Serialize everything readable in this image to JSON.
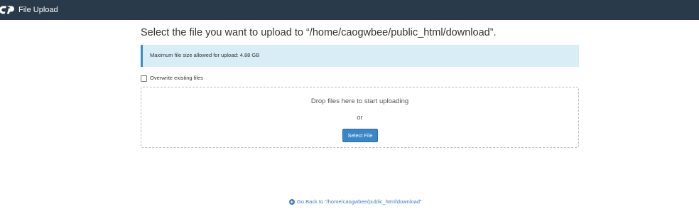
{
  "header": {
    "logo": "cpanel-logo",
    "title": "File Upload"
  },
  "main": {
    "heading": "Select the file you want to upload to “/home/caogwbee/public_html/download”.",
    "info": "Maximum file size allowed for upload: 4.88 GB",
    "overwrite": {
      "label": "Overwrite existing files",
      "checked": false
    },
    "dropzone": {
      "prompt": "Drop files here to start uploading",
      "or": "or",
      "button_label": "Select File"
    }
  },
  "footer": {
    "back_icon": "arrow-circle-left-icon",
    "back_label": "Go Back to “/home/caogwbee/public_html/download”"
  },
  "colors": {
    "topbar": "#293a4a",
    "info_bg": "#d9edf7",
    "accent": "#3a87c8",
    "link": "#3a7fc1"
  }
}
